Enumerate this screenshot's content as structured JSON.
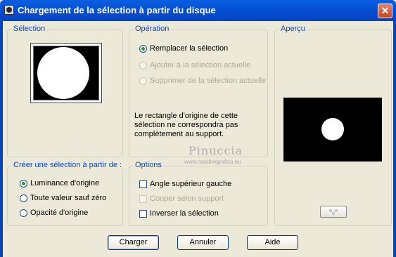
{
  "window": {
    "title": "Chargement de la sélection à partir du disque",
    "close_glyph": "✕"
  },
  "selection_group": {
    "label": "Sélection"
  },
  "operation_group": {
    "label": "Opération",
    "options": [
      {
        "label": "Remplacer la sélection",
        "checked": true,
        "enabled": true
      },
      {
        "label": "Ajouter à la sélection actuelle",
        "checked": false,
        "enabled": false
      },
      {
        "label": "Supprimer de la sélection actuelle",
        "checked": false,
        "enabled": false
      }
    ],
    "note": "Le rectangle d'origine de cette sélection ne correspondra pas complètement au support."
  },
  "preview_group": {
    "label": "Aperçu"
  },
  "create_group": {
    "label": "Créer une sélection à partir de :",
    "options": [
      {
        "label": "Luminance d'origine",
        "checked": true
      },
      {
        "label": "Toute valeur sauf zéro",
        "checked": false
      },
      {
        "label": "Opacité d'origine",
        "checked": false
      }
    ]
  },
  "options_group": {
    "label": "Options",
    "checks": [
      {
        "label": "Angle supérieur gauche",
        "checked": false,
        "enabled": true
      },
      {
        "label": "Couper selon support",
        "checked": false,
        "enabled": false
      },
      {
        "label": "Inverser la sélection",
        "checked": false,
        "enabled": true
      }
    ]
  },
  "watermark": {
    "line1": "Pinuccia",
    "line2": "www.maidiregrafica.eu"
  },
  "buttons": {
    "ok": "Charger",
    "cancel": "Annuler",
    "help": "Aide"
  },
  "colors": {
    "title_bar": "#0550d4",
    "legend": "#0046d5",
    "face": "#ece9d8",
    "radio_dot": "#21a121"
  }
}
